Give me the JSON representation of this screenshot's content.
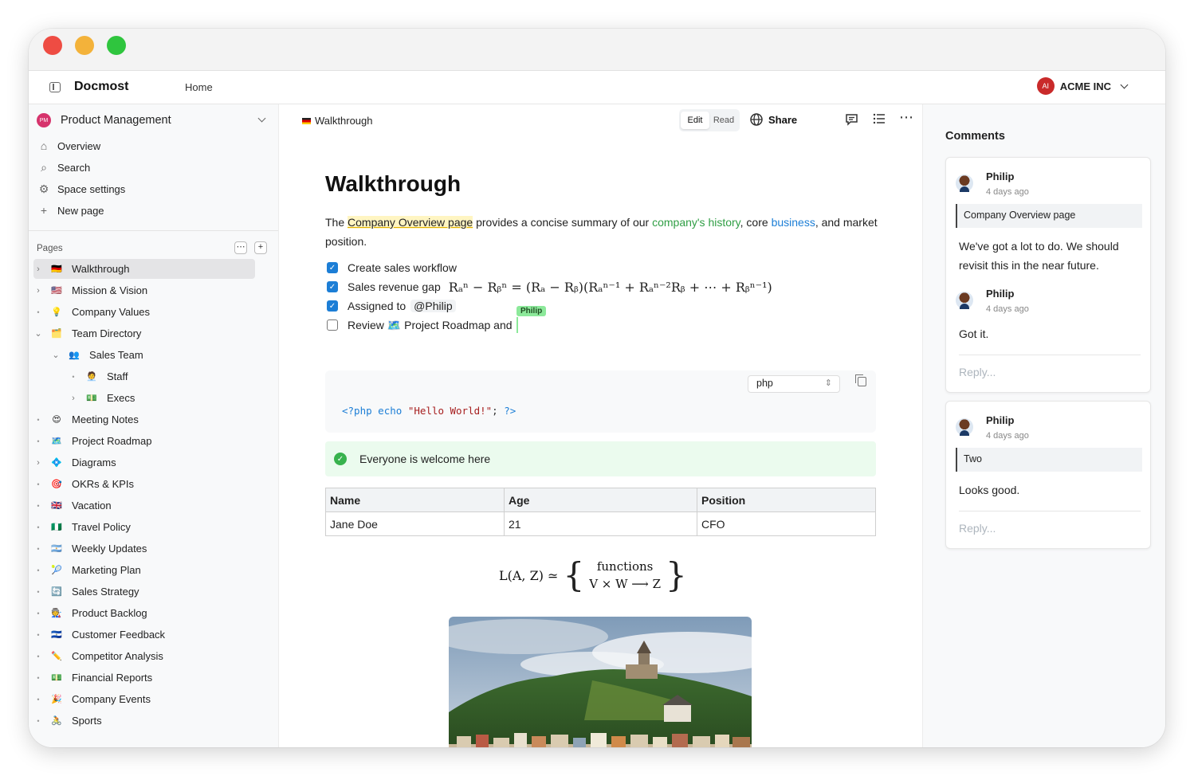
{
  "app": {
    "brand": "Docmost",
    "home": "Home",
    "org_initials": "AI",
    "org_name": "ACME INC"
  },
  "sidebar": {
    "space_initials": "PM",
    "space_name": "Product Management",
    "nav": [
      {
        "icon": "home-icon",
        "label": "Overview"
      },
      {
        "icon": "search-icon",
        "label": "Search"
      },
      {
        "icon": "gear-icon",
        "label": "Space settings"
      },
      {
        "icon": "plus-icon",
        "label": "New page"
      }
    ],
    "pages_label": "Pages",
    "tree": [
      {
        "label": "Walkthrough",
        "emoji": "🇩🇪",
        "depth": 0,
        "kind": "caret-right",
        "active": true
      },
      {
        "label": "Mission & Vision",
        "emoji": "🇺🇸",
        "depth": 0,
        "kind": "caret-right"
      },
      {
        "label": "Company Values",
        "emoji": "💡",
        "depth": 0,
        "kind": "dot"
      },
      {
        "label": "Team Directory",
        "emoji": "🗂️",
        "depth": 0,
        "kind": "caret-down"
      },
      {
        "label": "Sales Team",
        "emoji": "👥",
        "depth": 1,
        "kind": "caret-down"
      },
      {
        "label": "Staff",
        "emoji": "🧑‍💼",
        "depth": 2,
        "kind": "dot"
      },
      {
        "label": "Execs",
        "emoji": "💵",
        "depth": 2,
        "kind": "caret-right"
      },
      {
        "label": "Meeting Notes",
        "emoji": "😍",
        "depth": 0,
        "kind": "dot"
      },
      {
        "label": "Project Roadmap",
        "emoji": "🗺️",
        "depth": 0,
        "kind": "dot"
      },
      {
        "label": "Diagrams",
        "emoji": "💠",
        "depth": 0,
        "kind": "caret-right"
      },
      {
        "label": "OKRs & KPIs",
        "emoji": "🎯",
        "depth": 0,
        "kind": "dot"
      },
      {
        "label": "Vacation",
        "emoji": "🇬🇧",
        "depth": 0,
        "kind": "dot"
      },
      {
        "label": "Travel Policy",
        "emoji": "🇳🇬",
        "depth": 0,
        "kind": "dot"
      },
      {
        "label": "Weekly Updates",
        "emoji": "🇦🇷",
        "depth": 0,
        "kind": "dot"
      },
      {
        "label": "Marketing Plan",
        "emoji": "🎾",
        "depth": 0,
        "kind": "dot"
      },
      {
        "label": "Sales Strategy",
        "emoji": "🔄",
        "depth": 0,
        "kind": "dot"
      },
      {
        "label": "Product Backlog",
        "emoji": "🧑‍🏭",
        "depth": 0,
        "kind": "dot"
      },
      {
        "label": "Customer Feedback",
        "emoji": "🇸🇻",
        "depth": 0,
        "kind": "dot"
      },
      {
        "label": "Competitor Analysis",
        "emoji": "✏️",
        "depth": 0,
        "kind": "dot"
      },
      {
        "label": "Financial Reports",
        "emoji": "💵",
        "depth": 0,
        "kind": "dot"
      },
      {
        "label": "Company Events",
        "emoji": "🎉",
        "depth": 0,
        "kind": "dot"
      },
      {
        "label": "Sports",
        "emoji": "🚴",
        "depth": 0,
        "kind": "dot"
      }
    ]
  },
  "header": {
    "breadcrumb": "Walkthrough",
    "mode_edit": "Edit",
    "mode_read": "Read",
    "share": "Share"
  },
  "doc": {
    "title": "Walkthrough",
    "intro": {
      "before": "The ",
      "link1": "Company Overview page",
      "mid1": " provides a concise summary of our ",
      "link2": "company's history",
      "mid2": ", core ",
      "link3": "business",
      "after": ", and market position."
    },
    "tasks": [
      {
        "text": "Create sales workflow",
        "checked": true
      },
      {
        "text": "Sales revenue gap",
        "checked": true,
        "math": "Rₐⁿ − Rᵦⁿ = (Rₐ − Rᵦ)(Rₐⁿ⁻¹ + Rₐⁿ⁻²Rᵦ + ⋯ + Rᵦⁿ⁻¹)"
      },
      {
        "text": "Assigned to",
        "checked": true,
        "mention": "@Philip"
      },
      {
        "text": "Review 🗺️ Project Roadmap and",
        "checked": false
      }
    ],
    "cursor_user": "Philip",
    "code": {
      "language": "php",
      "open": "<?php",
      "echo": "echo",
      "string": "\"Hello World!\"",
      "semi": ";",
      "close": "?>"
    },
    "callout": "Everyone is welcome here",
    "table": {
      "headers": [
        "Name",
        "Age",
        "Position"
      ],
      "rows": [
        [
          "Jane Doe",
          "21",
          "CFO"
        ]
      ]
    },
    "formula": {
      "lhs": "L(A, Z) ≃",
      "top": "functions",
      "bottom": "V × W  ⟶  Z"
    }
  },
  "comments": {
    "title": "Comments",
    "threads": [
      {
        "quote": "Company Overview page",
        "reply_placeholder": "Reply...",
        "items": [
          {
            "author": "Philip",
            "time": "4 days ago",
            "text": "We've got a lot to do. We should revisit this in the near future."
          },
          {
            "author": "Philip",
            "time": "4 days ago",
            "text": "Got it."
          }
        ]
      },
      {
        "quote": "Two",
        "reply_placeholder": "Reply...",
        "items": [
          {
            "author": "Philip",
            "time": "4 days ago",
            "text": "Looks good."
          }
        ]
      }
    ]
  },
  "colors": {
    "accent": "#1c7ed6",
    "callout_bg": "#ebfbee",
    "callout_icon": "#37b24d",
    "org_avatar": "#c92a2a",
    "space_avatar": "#d6336c"
  }
}
